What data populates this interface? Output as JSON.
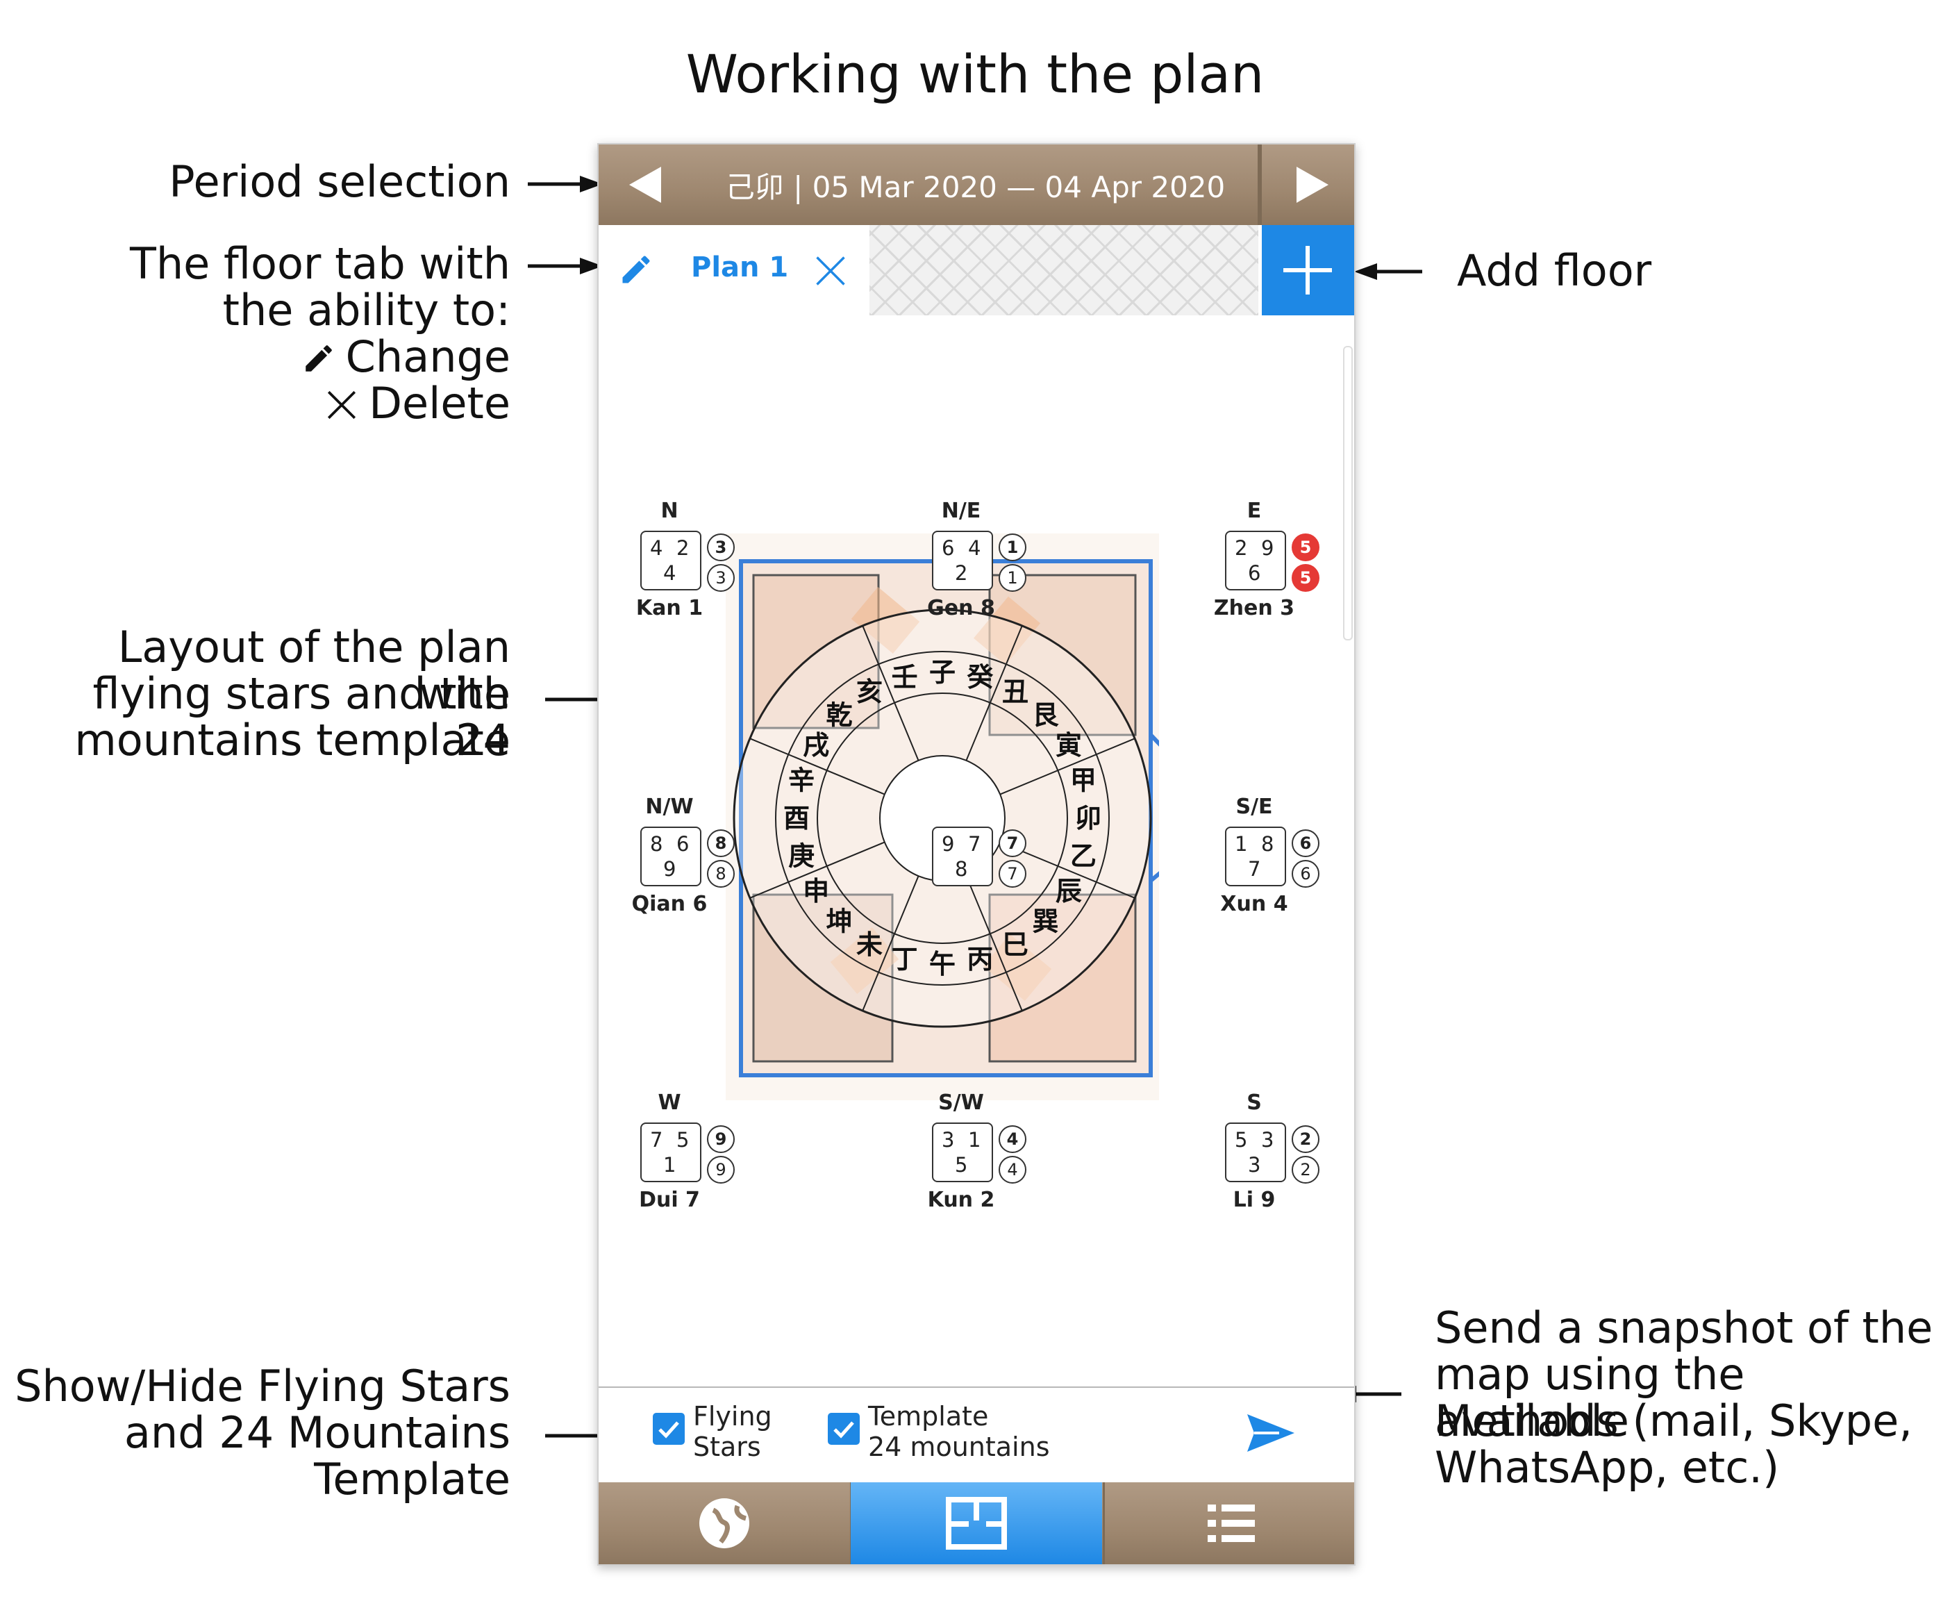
{
  "page": {
    "title": "Working with the plan"
  },
  "annotations": {
    "period": "Period selection",
    "floor_tab": [
      "The floor tab with",
      "the ability to:"
    ],
    "change": "Change",
    "delete": "Delete",
    "add_floor": "Add floor",
    "layout": [
      "Layout of the plan with",
      "flying stars and the 24",
      "mountains template"
    ],
    "toggles": [
      "Show/Hide Flying Stars",
      "and 24 Mountains",
      "Template"
    ],
    "snapshot": [
      "Send a snapshot of the",
      "map using the available",
      "Methods (mail, Skype,",
      "WhatsApp, etc.)"
    ]
  },
  "app": {
    "period_text": "己卯  |  05 Mar 2020 — 04 Apr 2020",
    "tab_label": "Plan 1",
    "flying_stars_label": [
      "Flying",
      "Stars"
    ],
    "template_label": [
      "Template",
      "24 mountains"
    ],
    "colors": {
      "accent": "#1e88e5",
      "wood": "#9e876f",
      "red_star": "#e53935"
    }
  },
  "palaces": [
    {
      "dir": "N",
      "n": "Kan 1",
      "tl": "4",
      "tr": "2",
      "b": "4",
      "c1": "3",
      "c2": "3",
      "red": false
    },
    {
      "dir": "N/E",
      "n": "Gen 8",
      "tl": "6",
      "tr": "4",
      "b": "2",
      "c1": "1",
      "c2": "1",
      "red": false
    },
    {
      "dir": "E",
      "n": "Zhen 3",
      "tl": "2",
      "tr": "9",
      "b": "6",
      "c1": "5",
      "c2": "5",
      "red": true
    },
    {
      "dir": "N/W",
      "n": "Qian 6",
      "tl": "8",
      "tr": "6",
      "b": "9",
      "c1": "8",
      "c2": "8",
      "red": false
    },
    {
      "dir": "",
      "n": "",
      "tl": "9",
      "tr": "7",
      "b": "8",
      "c1": "7",
      "c2": "7",
      "red": false
    },
    {
      "dir": "S/E",
      "n": "Xun 4",
      "tl": "1",
      "tr": "8",
      "b": "7",
      "c1": "6",
      "c2": "6",
      "red": false
    },
    {
      "dir": "W",
      "n": "Dui 7",
      "tl": "7",
      "tr": "5",
      "b": "1",
      "c1": "9",
      "c2": "9",
      "red": false
    },
    {
      "dir": "S/W",
      "n": "Kun 2",
      "tl": "3",
      "tr": "1",
      "b": "5",
      "c1": "4",
      "c2": "4",
      "red": false
    },
    {
      "dir": "S",
      "n": "Li 9",
      "tl": "5",
      "tr": "3",
      "b": "3",
      "c1": "2",
      "c2": "2",
      "red": false
    }
  ],
  "mountains": [
    "子",
    "癸",
    "丑",
    "艮",
    "寅",
    "甲",
    "卯",
    "乙",
    "辰",
    "巽",
    "巳",
    "丙",
    "午",
    "丁",
    "未",
    "坤",
    "申",
    "庚",
    "酉",
    "辛",
    "戌",
    "乾",
    "亥",
    "壬"
  ]
}
